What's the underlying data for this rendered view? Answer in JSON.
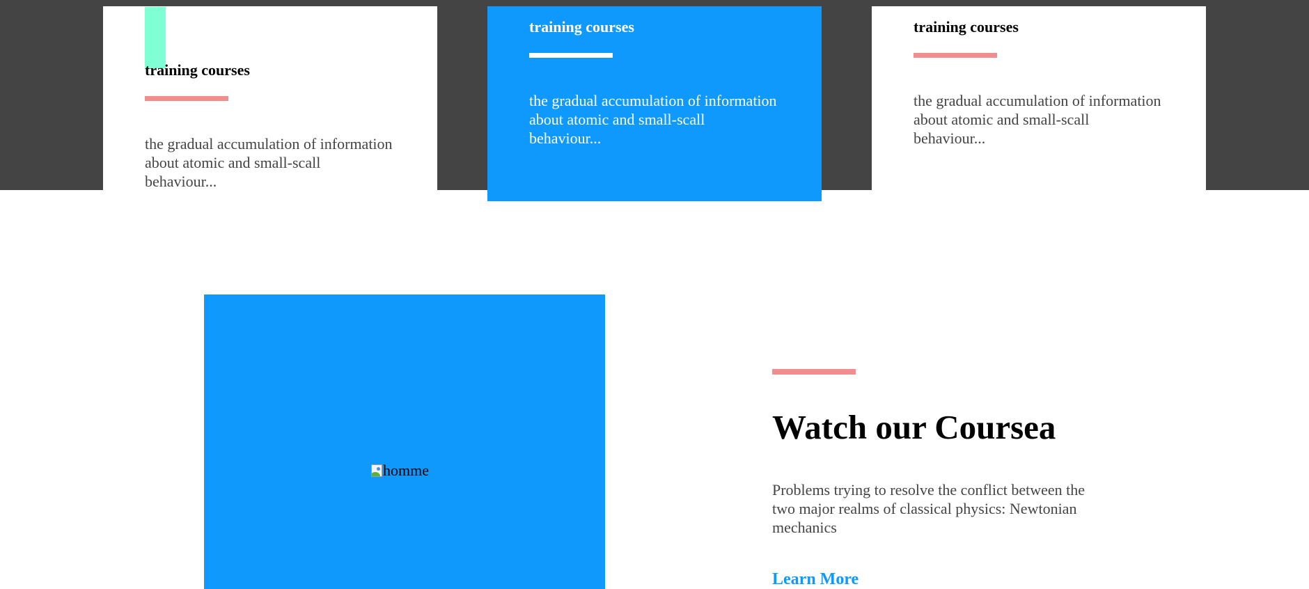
{
  "colors": {
    "band": "#444444",
    "accent_blue": "#0f99fd",
    "accent_pink": "#f08e8e",
    "accent_mint": "#7fffd4",
    "text_gray": "#444444"
  },
  "cards": [
    {
      "title": "training courses",
      "text": "the gradual accumulation of information about atomic and small-scall behaviour...",
      "highlighted": false
    },
    {
      "title": "training courses",
      "text": "the gradual accumulation of information about atomic and small-scall behaviour...",
      "highlighted": true
    },
    {
      "title": "training courses",
      "text": "the gradual accumulation of information about atomic and small-scall behaviour...",
      "highlighted": false
    }
  ],
  "media": {
    "image_alt": "homme",
    "icon": "broken-image-icon"
  },
  "feature": {
    "title": "Watch our Coursea",
    "text": "Problems trying to resolve the conflict between the two major realms of classical physics: Newtonian mechanics",
    "link_label": "Learn More"
  }
}
